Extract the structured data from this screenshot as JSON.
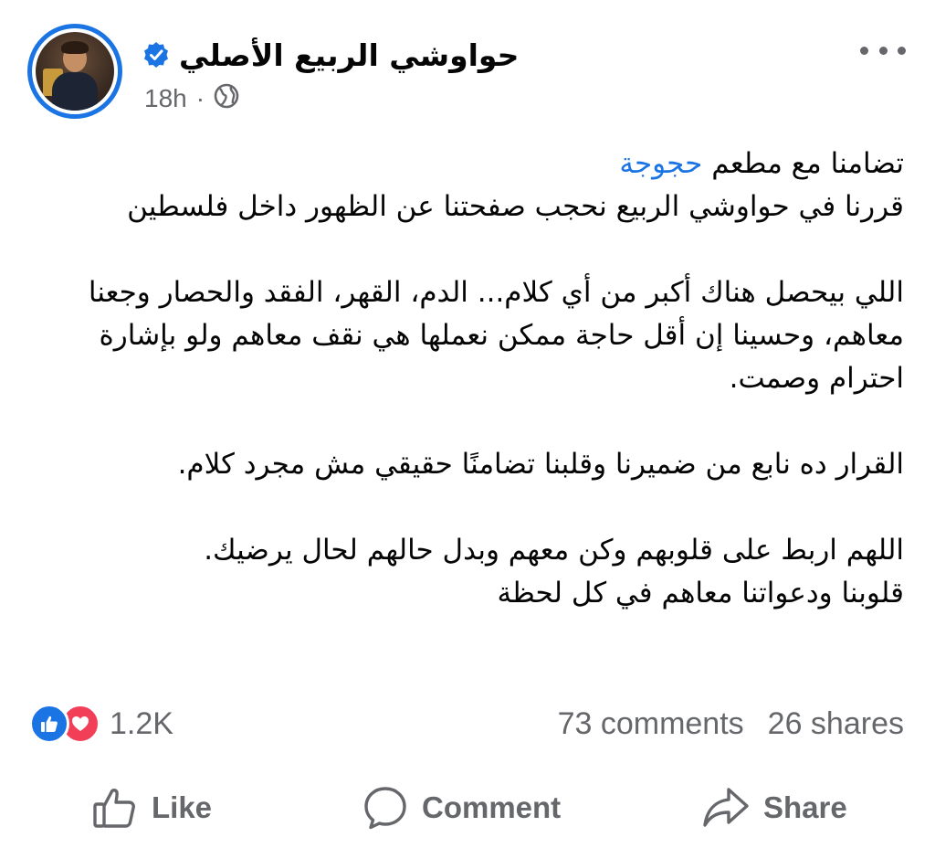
{
  "post": {
    "page_name": "حواوشي  الربيع  الأصلي",
    "verified_icon": "verified-badge-icon",
    "time": "18h",
    "separator": "·",
    "audience_icon": "globe-icon",
    "more_icon": "more-options-icon",
    "body": {
      "line1_text": "تضامنا مع مطعم ",
      "line1_mention": "حجوجة",
      "para1_rest": "قررنا في حواوشي الربيع نحجب صفحتنا عن الظهور داخل فلسطين",
      "para2": "اللي بيحصل هناك أكبر من أي كلام... الدم، القهر، الفقد والحصار وجعنا معاهم، وحسينا إن أقل حاجة ممكن نعملها هي نقف معاهم ولو بإشارة احترام وصمت.",
      "para3": "القرار ده نابع من ضميرنا وقلبنا تضامنًا حقيقي مش مجرد كلام.",
      "para4_line1": "اللهم اربط على قلوبهم وكن معهم وبدل حالهم لحال يرضيك.",
      "para4_line2": "قلوبنا ودعواتنا معاهم في كل لحظة"
    },
    "colors": {
      "link": "#1b74e4",
      "like": "#1b74e4",
      "love": "#f33e58",
      "meta": "#65676b"
    }
  },
  "stats": {
    "reactions_count": "1.2K",
    "comments": "73 comments",
    "shares": "26 shares"
  },
  "actions": {
    "like_label": "Like",
    "comment_label": "Comment",
    "share_label": "Share"
  }
}
